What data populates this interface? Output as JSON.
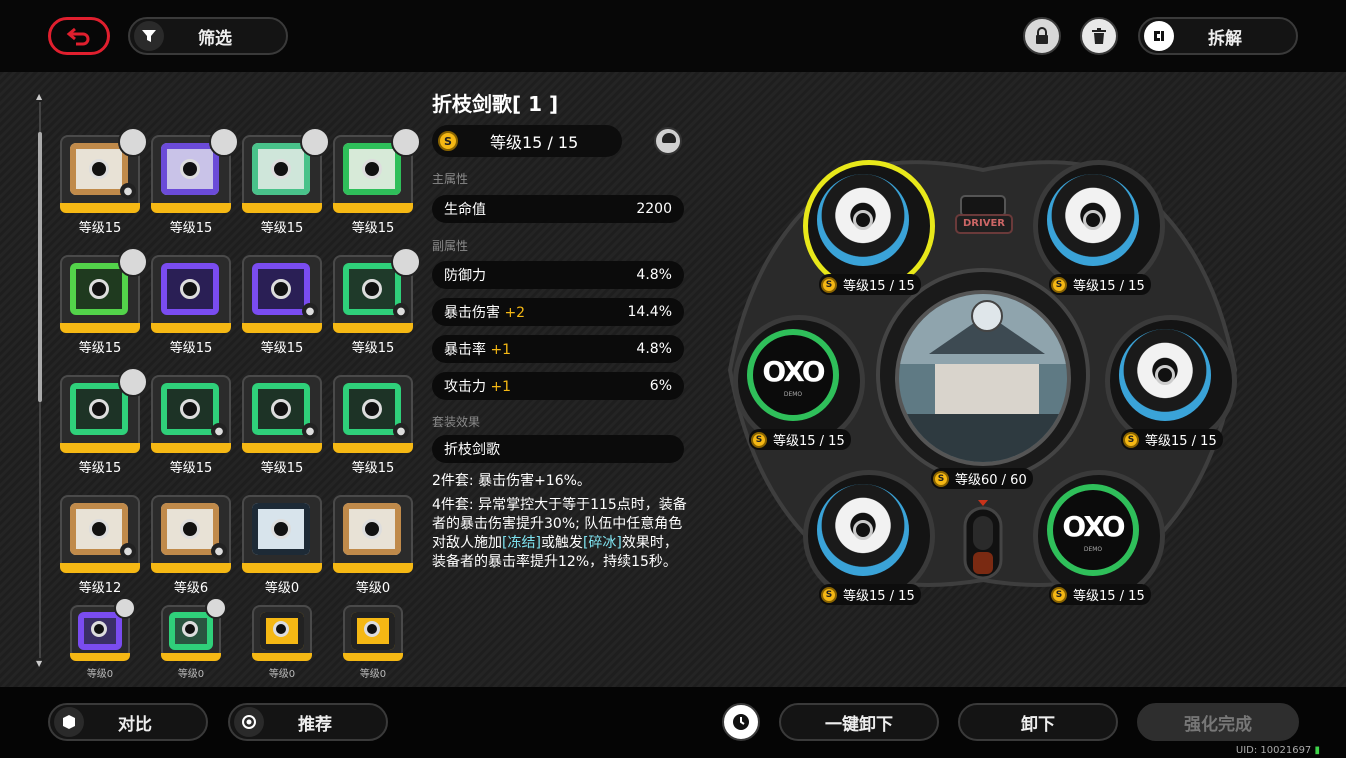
{
  "topbar": {
    "filter_label": "筛选",
    "disassemble_label": "拆解"
  },
  "grid": [
    {
      "level": "等级15",
      "art": "#e8e2d6",
      "accent": "#c08a4a",
      "avatar": true,
      "lock": true
    },
    {
      "level": "等级15",
      "art": "#c9c3e8",
      "accent": "#6b4bd8",
      "avatar": true,
      "lock": false
    },
    {
      "level": "等级15",
      "art": "#cfe6da",
      "accent": "#49c28a",
      "avatar": true,
      "lock": false
    },
    {
      "level": "等级15",
      "art": "#d7ead8",
      "accent": "#2fbf5a",
      "avatar": true,
      "lock": false
    },
    {
      "level": "等级15",
      "art": "#1f3a1f",
      "accent": "#53d34a",
      "avatar": true,
      "lock": false
    },
    {
      "level": "等级15",
      "art": "#2a1f55",
      "accent": "#7a4cf0",
      "avatar": false,
      "lock": false
    },
    {
      "level": "等级15",
      "art": "#2a1f55",
      "accent": "#7a4cf0",
      "avatar": false,
      "lock": true
    },
    {
      "level": "等级15",
      "art": "#1f3a2a",
      "accent": "#2fd07a",
      "avatar": true,
      "lock": true
    },
    {
      "level": "等级15",
      "art": "#1d3326",
      "accent": "#2fd07a",
      "avatar": true,
      "lock": false
    },
    {
      "level": "等级15",
      "art": "#1d3326",
      "accent": "#2fd07a",
      "avatar": false,
      "lock": true
    },
    {
      "level": "等级15",
      "art": "#1d3326",
      "accent": "#2fd07a",
      "avatar": false,
      "lock": true
    },
    {
      "level": "等级15",
      "art": "#1d3326",
      "accent": "#2fd07a",
      "avatar": false,
      "lock": true
    },
    {
      "level": "等级12",
      "art": "#e8e2d6",
      "accent": "#c08a4a",
      "avatar": false,
      "lock": true
    },
    {
      "level": "等级6",
      "art": "#e8e2d6",
      "accent": "#c08a4a",
      "avatar": false,
      "lock": true
    },
    {
      "level": "等级0",
      "art": "#d8e4ec",
      "accent": "#1d2a36",
      "avatar": false,
      "lock": false
    },
    {
      "level": "等级0",
      "art": "#e8e2d6",
      "accent": "#c08a4a",
      "avatar": false,
      "lock": false
    },
    {
      "level": "等级0",
      "art": "#3a2f66",
      "accent": "#7a4cf0",
      "avatar": true,
      "lock": false
    },
    {
      "level": "等级0",
      "art": "#2a5540",
      "accent": "#2fd07a",
      "avatar": true,
      "lock": false
    },
    {
      "level": "等级0",
      "art": "#f5b814",
      "accent": "#222222",
      "avatar": false,
      "lock": false
    },
    {
      "level": "等级0",
      "art": "#f5b814",
      "accent": "#222222",
      "avatar": false,
      "lock": false
    }
  ],
  "detail": {
    "title": "折枝剑歌[ 1 ]",
    "level": "等级15 / 15",
    "coin_glyph": "S",
    "main_stat_header": "主属性",
    "main_stat": {
      "name": "生命值",
      "value": "2200"
    },
    "sub_stat_header": "副属性",
    "sub_stats": [
      {
        "name": "防御力",
        "plus": "",
        "value": "4.8%"
      },
      {
        "name": "暴击伤害",
        "plus": "+2",
        "value": "14.4%"
      },
      {
        "name": "暴击率",
        "plus": "+1",
        "value": "4.8%"
      },
      {
        "name": "攻击力",
        "plus": "+1",
        "value": "6%"
      }
    ],
    "set_header": "套装效果",
    "set_name": "折枝剑歌",
    "set2": "2件套: 暴击伤害+16%。",
    "set4_a": "4件套: 异常掌控大于等于115点时，装备者的暴击伤害提升30%; 队伍中任意角色对敌人施加",
    "set4_hl1": "[冻结]",
    "set4_b": "或触发",
    "set4_hl2": "[碎冰]",
    "set4_c": "效果时，装备者的暴击率提升12%，持续15秒。"
  },
  "wheel": {
    "driver_label": "DRIVER",
    "center_level": "等级60 / 60",
    "slot_levels": [
      "等级15 / 15",
      "等级15 / 15",
      "等级15 / 15",
      "等级15 / 15",
      "等级15 / 15",
      "等级15 / 15"
    ],
    "disc_text_a": "OXO",
    "disc_text_b": "DEMO"
  },
  "bottombar": {
    "compare_label": "对比",
    "recommend_label": "推荐",
    "unequip_all_label": "一键卸下",
    "unequip_label": "卸下",
    "enhance_done_label": "强化完成",
    "uid": "UID: 10021697"
  },
  "colors": {
    "gold": "#f5b814",
    "selected_ring": "#e8e81a",
    "back_red": "#e01f2e",
    "green_disc": "#2fbf5a"
  }
}
